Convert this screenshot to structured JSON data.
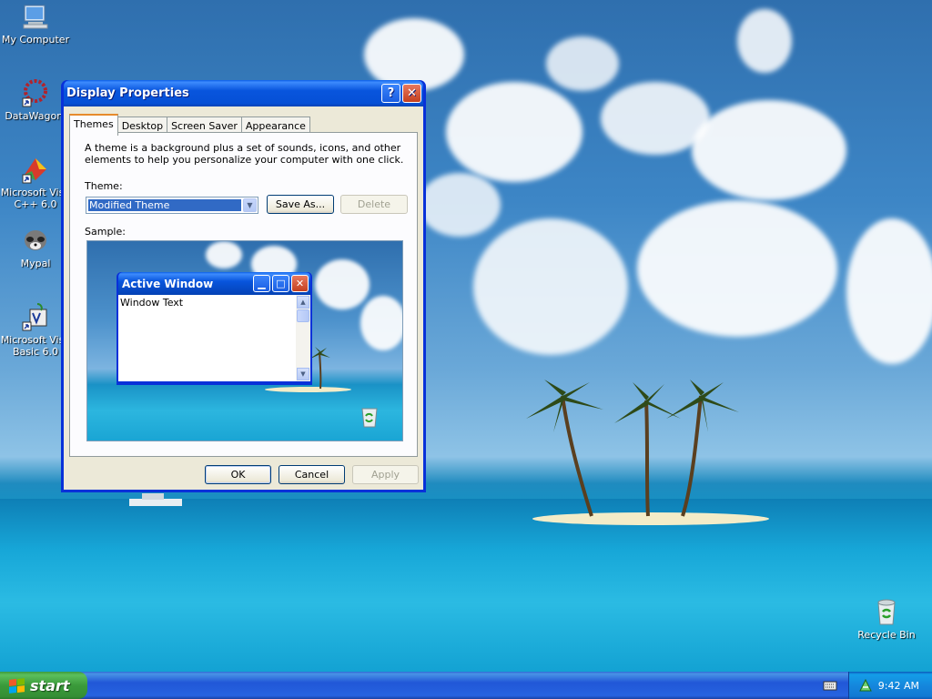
{
  "desktop": {
    "icons": [
      {
        "label": "My Computer",
        "icon": "my-computer-icon"
      },
      {
        "label": "DataWagon.",
        "icon": "datawagon-icon"
      },
      {
        "label": "Microsoft Visu C++ 6.0",
        "icon": "visual-cpp-icon"
      },
      {
        "label": "Mypal",
        "icon": "mypal-icon"
      },
      {
        "label": "Microsoft Visu Basic 6.0",
        "icon": "visual-basic-icon"
      },
      {
        "label": "Recycle Bin",
        "icon": "recycle-bin-icon"
      }
    ]
  },
  "dialog": {
    "title": "Display Properties",
    "help_glyph": "?",
    "close_glyph": "✕",
    "tabs": [
      {
        "label": "Themes",
        "active": true
      },
      {
        "label": "Desktop",
        "active": false
      },
      {
        "label": "Screen Saver",
        "active": false
      },
      {
        "label": "Appearance",
        "active": false
      }
    ],
    "description": "A theme is a background plus a set of sounds, icons, and other elements to help you personalize your computer with one click.",
    "theme_label": "Theme:",
    "theme_value": "Modified Theme",
    "save_as_label": "Save As...",
    "delete_label": "Delete",
    "sample_label": "Sample:",
    "sample_window": {
      "title": "Active Window",
      "text": "Window Text"
    },
    "ok_label": "OK",
    "cancel_label": "Cancel",
    "apply_label": "Apply"
  },
  "taskbar": {
    "start_label": "start",
    "clock": "9:42 AM"
  },
  "colors": {
    "title_blue": "#0855dd",
    "start_green": "#3a9a3a",
    "selection": "#316ac5",
    "dialog_face": "#ece9d8"
  }
}
